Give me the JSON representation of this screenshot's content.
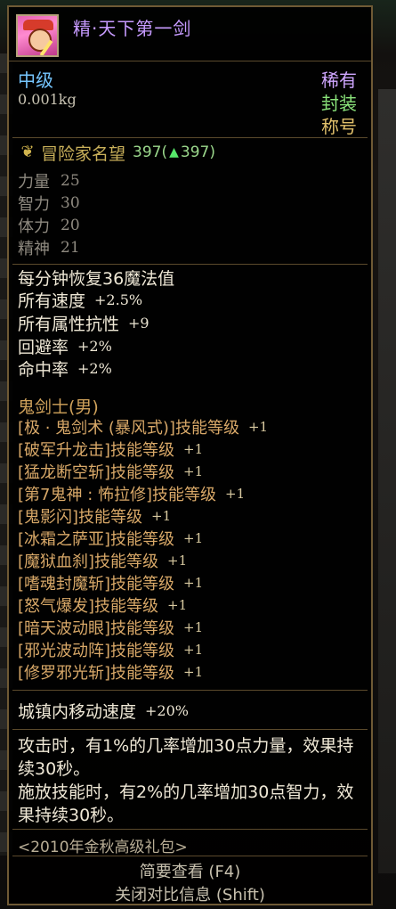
{
  "item": {
    "name": "精·天下第一剑",
    "icon": "swordsman-portrait-icon",
    "grade": "中级",
    "weight": "0.001kg",
    "rarity": "稀有",
    "seal": "封装",
    "type": "称号"
  },
  "fame": {
    "icon": "laurel-crest-icon",
    "label": "冒险家名望",
    "value": "397(",
    "up_arrow": "▲",
    "delta": "397)"
  },
  "base_stats": [
    {
      "label": "力量",
      "value": "25"
    },
    {
      "label": "智力",
      "value": "30"
    },
    {
      "label": "体力",
      "value": "20"
    },
    {
      "label": "精神",
      "value": "21"
    }
  ],
  "effects": [
    {
      "label": "每分钟恢复36魔法值",
      "value": ""
    },
    {
      "label": "所有速度",
      "value": "+2.5%"
    },
    {
      "label": "所有属性抗性",
      "value": "+9"
    },
    {
      "label": "回避率",
      "value": "+2%"
    },
    {
      "label": "命中率",
      "value": "+2%"
    }
  ],
  "class_name": "鬼剑士(男)",
  "skills": [
    {
      "label": "[极 · 鬼剑术 (暴风式)]技能等级",
      "value": "+1"
    },
    {
      "label": "[破军升龙击]技能等级",
      "value": "+1"
    },
    {
      "label": "[猛龙断空斩]技能等级",
      "value": "+1"
    },
    {
      "label": "[第7鬼神 : 怖拉修]技能等级",
      "value": "+1"
    },
    {
      "label": "[鬼影闪]技能等级",
      "value": "+1"
    },
    {
      "label": "[冰霜之萨亚]技能等级",
      "value": "+1"
    },
    {
      "label": "[魔狱血刹]技能等级",
      "value": "+1"
    },
    {
      "label": "[嗜魂封魔斩]技能等级",
      "value": "+1"
    },
    {
      "label": "[怒气爆发]技能等级",
      "value": "+1"
    },
    {
      "label": "[暗天波动眼]技能等级",
      "value": "+1"
    },
    {
      "label": "[邪光波动阵]技能等级",
      "value": "+1"
    },
    {
      "label": "[修罗邪光斩]技能等级",
      "value": "+1"
    }
  ],
  "town_speed": {
    "label": "城镇内移动速度",
    "value": "+20%"
  },
  "descriptions": [
    "攻击时，有1%的几率增加30点力量，效果持续30秒。",
    "施放技能时，有2%的几率增加30点智力，效果持续30秒。"
  ],
  "package": "<2010年金秋高级礼包>",
  "footer": {
    "brief_view": "简要查看 (F4)",
    "close_compare": "关闭对比信息 (Shift)"
  },
  "colors": {
    "name": "#c79bff",
    "grade": "#76c6ff",
    "rarity": "#cfa6ff",
    "seal": "#8be47b",
    "type": "#e1c06b",
    "class": "#d0a25b",
    "skill": "#d8a868",
    "border": "#6f5a35"
  }
}
